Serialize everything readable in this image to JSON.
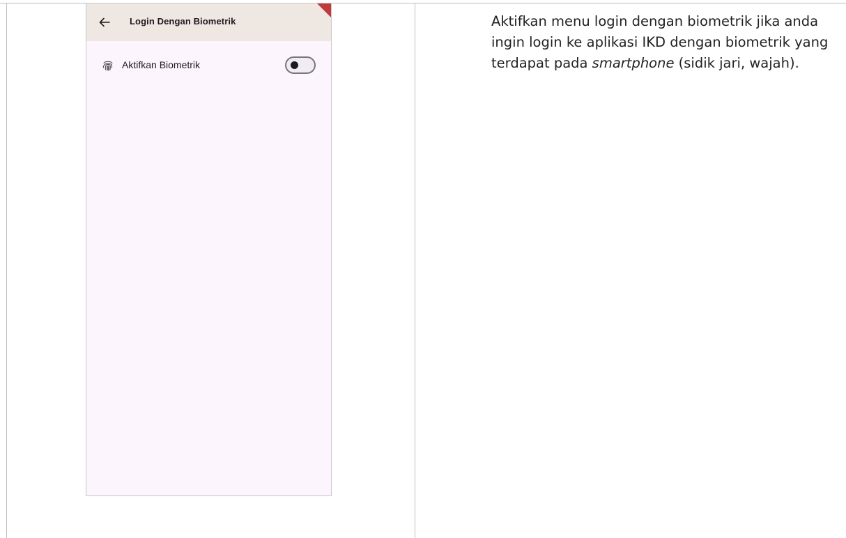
{
  "screen": {
    "title": "Login Dengan Biometrik",
    "back_icon": "arrow-left-icon",
    "setting_row": {
      "icon": "fingerprint-icon",
      "label": "Aktifkan Biometrik",
      "toggle_on": false
    }
  },
  "description": {
    "part1": "Aktifkan menu login dengan biometrik jika anda ingin login ke aplikasi IKD dengan biometrik yang terdapat pada ",
    "emphasis": "smartphone",
    "part2": " (sidik jari, wajah)."
  },
  "colors": {
    "appbar_bg": "#efe8e2",
    "screen_bg": "#fcf5fe",
    "debug_banner": "#c0393b",
    "text_primary": "#1d1b20",
    "toggle_outline": "#7a757f"
  }
}
